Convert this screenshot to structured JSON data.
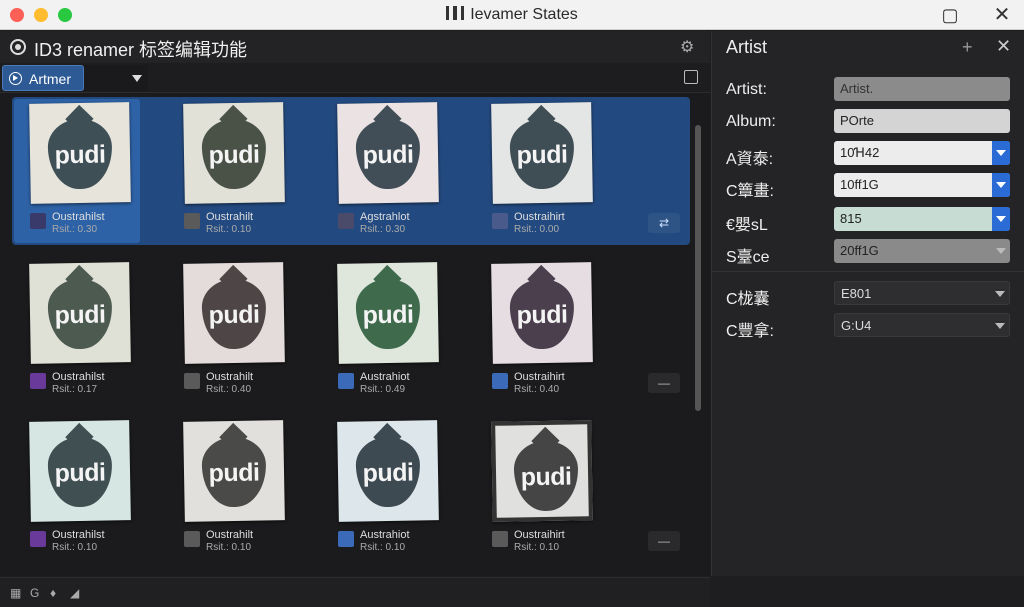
{
  "window": {
    "title": "Ievamer States"
  },
  "left_pane": {
    "title": "ID3 renamer 标签编辑功能",
    "tab_label": "Artmer"
  },
  "albums": [
    {
      "name": "Oustrahilst",
      "sub": "Rsit.: 0.30",
      "tint": "#3e4f55",
      "bg": "#e7e4dc",
      "icon_color": "#3a3a6a"
    },
    {
      "name": "Oustrahilt",
      "sub": "Rsit.: 0.10",
      "tint": "#4a5247",
      "bg": "#e2e1d8",
      "icon_color": "#5a5a5a"
    },
    {
      "name": "Agstrahlot",
      "sub": "Rsit.: 0.30",
      "tint": "#414e57",
      "bg": "#ebe3e3",
      "icon_color": "#4a4a6a"
    },
    {
      "name": "Oustraihirt",
      "sub": "Rsit.: 0.00",
      "tint": "#3f4d55",
      "bg": "#e3e6e4",
      "icon_color": "#4a5a8a"
    },
    {
      "name": "Oustrahilst",
      "sub": "Rsit.: 0.17",
      "tint": "#4d5a4f",
      "bg": "#dfe0d6",
      "icon_color": "#6a3a9a"
    },
    {
      "name": "Oustrahilt",
      "sub": "Rsit.: 0.40",
      "tint": "#4e4646",
      "bg": "#e4dcdb",
      "icon_color": "#5a5a5a"
    },
    {
      "name": "Austrahiot",
      "sub": "Rsit.: 0.49",
      "tint": "#3f6a4c",
      "bg": "#dfe7dd",
      "icon_color": "#3a6ab8"
    },
    {
      "name": "Oustraihirt",
      "sub": "Rsit.: 0.40",
      "tint": "#4b3f4d",
      "bg": "#e6dde3",
      "icon_color": "#3a6ab8"
    },
    {
      "name": "Oustrahilst",
      "sub": "Rsit.: 0.10",
      "tint": "#3f4f52",
      "bg": "#d6e6e2",
      "icon_color": "#6a3a9a"
    },
    {
      "name": "Oustrahilt",
      "sub": "Rsit.: 0.10",
      "tint": "#4a4a48",
      "bg": "#e2e0dc",
      "icon_color": "#5a5a5a"
    },
    {
      "name": "Austrahiot",
      "sub": "Rsit.: 0.10",
      "tint": "#3e4a52",
      "bg": "#dde6ea",
      "icon_color": "#3a6ab8"
    },
    {
      "name": "Oustraihirt",
      "sub": "Rsit.: 0.10",
      "tint": "#454545",
      "bg": "#e0e0de",
      "icon_color": "#5a5a5a"
    }
  ],
  "cover_text": "pudi",
  "row_buttons": [
    "⇄",
    "—",
    "—"
  ],
  "status_icons": [
    "▦",
    "G",
    "♦",
    "◢"
  ],
  "right_pane": {
    "title": "Artist",
    "fields": [
      {
        "label": "Artist:",
        "value": "Artist.",
        "style": "grey",
        "dropdown": ""
      },
      {
        "label": "Album:",
        "value": "POrte",
        "style": "light",
        "dropdown": ""
      },
      {
        "label": "A資泰:",
        "value": "10Ɦ42",
        "style": "white",
        "dropdown": "blue"
      },
      {
        "label": "C簟畫:",
        "value": "10ff1G",
        "style": "white",
        "dropdown": "blue"
      },
      {
        "label": "€嬰sL",
        "value": "815",
        "style": "mint",
        "dropdown": "blue"
      },
      {
        "label": "S臺ce",
        "value": "20ff1G",
        "style": "greyd",
        "dropdown": "plain"
      },
      {
        "label": "C栊囊",
        "value": "E801",
        "style": "dark",
        "dropdown": "plain"
      },
      {
        "label": "C豐拿:",
        "value": "G:U4",
        "style": "dark",
        "dropdown": "plain"
      }
    ]
  }
}
